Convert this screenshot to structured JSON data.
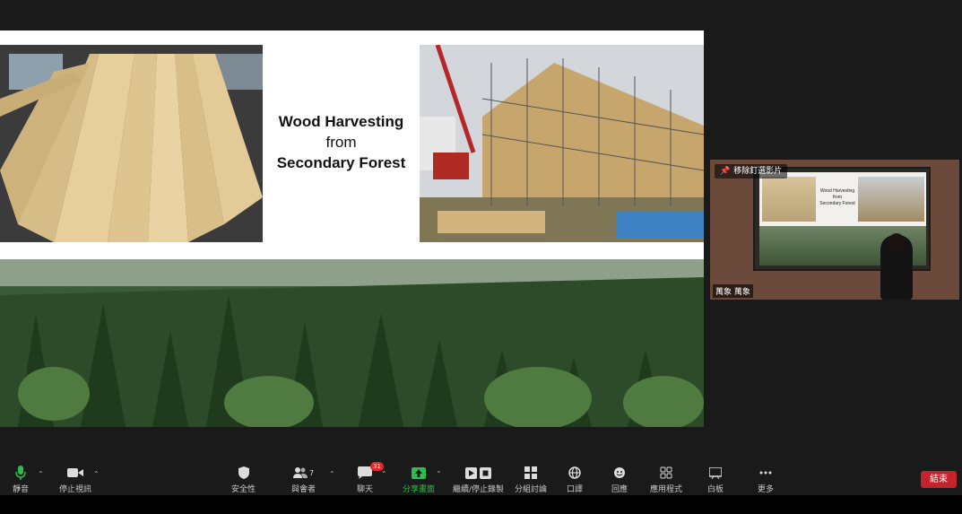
{
  "slide": {
    "title_line1": "Wood Harvesting",
    "title_line2": "from",
    "title_line3": "Secondary Forest"
  },
  "video": {
    "pin_label": "移除釘選影片",
    "participant_name": "萬象 萬象",
    "mini_title1": "Wood Harvesting",
    "mini_title2": "from",
    "mini_title3": "Secondary Forest"
  },
  "toolbar": {
    "mute": "靜音",
    "stop_video": "停止視訊",
    "security": "安全性",
    "participants": "與會者",
    "participants_count": "7",
    "chat": "聊天",
    "chat_badge": "31",
    "share_screen": "分享畫面",
    "record": "繼續/停止錄製",
    "breakout": "分組討論",
    "interpretation": "口譯",
    "reactions": "回應",
    "apps": "應用程式",
    "whiteboard": "白板",
    "more": "更多",
    "end": "結束"
  },
  "colors": {
    "share_accent": "#2dbd4c",
    "mic_accent": "#2dbd4c",
    "end_red": "#c4232b",
    "badge_red": "#e02828"
  }
}
